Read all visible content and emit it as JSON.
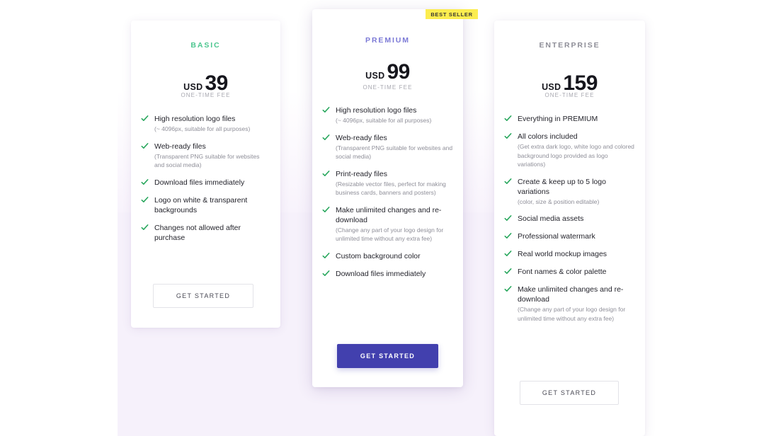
{
  "badge": {
    "label": "BEST SELLER",
    "color": "#fced4f"
  },
  "colors": {
    "basic_accent": "#4cc68f",
    "premium_accent": "#7b79d6",
    "enterprise_accent": "#8d8d97",
    "primary_button": "#4240ae",
    "check": "#26a65b",
    "page_background": "#f6f1fb"
  },
  "plans": [
    {
      "name": "BASIC",
      "currency": "USD",
      "price": "39",
      "fee_note": "ONE-TIME FEE",
      "cta": "GET STARTED",
      "features": [
        {
          "title": "High resolution logo files",
          "sub": "(~ 4096px, suitable for all purposes)"
        },
        {
          "title": "Web-ready files",
          "sub": "(Transparent PNG suitable for websites and social media)"
        },
        {
          "title": "Download files immediately",
          "sub": ""
        },
        {
          "title": "Logo on white & transparent backgrounds",
          "sub": ""
        },
        {
          "title": "Changes not allowed after purchase",
          "sub": ""
        }
      ]
    },
    {
      "name": "PREMIUM",
      "currency": "USD",
      "price": "99",
      "fee_note": "ONE-TIME FEE",
      "cta": "GET STARTED",
      "features": [
        {
          "title": "High resolution logo files",
          "sub": "(~ 4096px, suitable for all purposes)"
        },
        {
          "title": "Web-ready files",
          "sub": "(Transparent PNG suitable for websites and social media)"
        },
        {
          "title": "Print-ready files",
          "sub": "(Resizable vector files, perfect for making business cards, banners and posters)"
        },
        {
          "title": "Make unlimited changes and re-download",
          "sub": "(Change any part of your logo design for unlimited time without any extra fee)"
        },
        {
          "title": "Custom background color",
          "sub": ""
        },
        {
          "title": "Download files immediately",
          "sub": ""
        }
      ]
    },
    {
      "name": "ENTERPRISE",
      "currency": "USD",
      "price": "159",
      "fee_note": "ONE-TIME FEE",
      "cta": "GET STARTED",
      "features": [
        {
          "title": "Everything in PREMIUM",
          "sub": ""
        },
        {
          "title": "All colors included",
          "sub": "(Get extra dark logo, white logo and colored background logo provided as logo variations)"
        },
        {
          "title": "Create & keep up to 5 logo variations",
          "sub": "(color, size & position editable)"
        },
        {
          "title": "Social media assets",
          "sub": ""
        },
        {
          "title": "Professional watermark",
          "sub": ""
        },
        {
          "title": "Real world mockup images",
          "sub": ""
        },
        {
          "title": "Font names & color palette",
          "sub": ""
        },
        {
          "title": "Make unlimited changes and re-download",
          "sub": "(Change any part of your logo design for unlimited time without any extra fee)"
        }
      ]
    }
  ]
}
